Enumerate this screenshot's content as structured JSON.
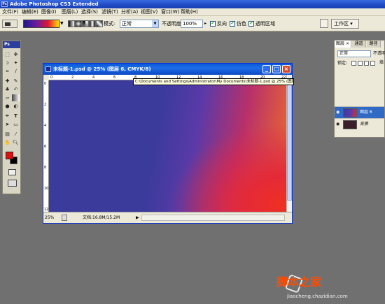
{
  "app": {
    "title": "Adobe Photoshop CS3 Extended",
    "toolbox_label": "Ps"
  },
  "menu": [
    "文件(F)",
    "编辑(E)",
    "图像(I)",
    "图层(L)",
    "选择(S)",
    "滤镜(T)",
    "分析(A)",
    "视图(V)",
    "窗口(W)",
    "帮助(H)"
  ],
  "options": {
    "mode_label": "模式:",
    "mode_value": "正常",
    "opacity_label": "不透明度:",
    "opacity_value": "100%",
    "reverse_label": "反向",
    "dither_label": "仿色",
    "transparency_label": "透明区域",
    "workspace_label": "工作区 ▾",
    "gradient_colors": [
      "#1a1a8a",
      "#6a1aa0",
      "#e01a30",
      "#ffe000"
    ]
  },
  "document": {
    "title": "未标题-1.psd @ 25% (图层 6, CMYK/8)",
    "zoom": "25%",
    "doc_size": "文档:16.8M/15.2M",
    "tooltip": "C:\\Documents and Settings\\Administrator\\My Documents\\未标题-1.psd @ 25% (图层 6, CMYK/8)",
    "ruler_top": [
      "0",
      "2",
      "4",
      "6",
      "8",
      "10",
      "12",
      "14",
      "16",
      "18",
      "20",
      "22"
    ],
    "ruler_left": [
      "0",
      "2",
      "4",
      "6",
      "8",
      "10",
      "12"
    ],
    "canvas_colors": [
      "#3b3b9c",
      "#5a3aa8",
      "#e42a38",
      "#f07028"
    ]
  },
  "layers_panel": {
    "tabs": [
      "图层 ×",
      "通道",
      "路径"
    ],
    "blend_mode": "正常",
    "opacity_label": "不透明",
    "lock_label": "锁定:",
    "fill_label": "填",
    "layers": [
      {
        "name": "图层 6",
        "selected": true
      },
      {
        "name": "背景",
        "selected": false
      }
    ]
  },
  "toolbox": {
    "tools": [
      "marquee-tool",
      "move-tool",
      "lasso-tool",
      "magic-wand-tool",
      "crop-tool",
      "slice-tool",
      "healing-brush-tool",
      "brush-tool",
      "clone-stamp-tool",
      "history-brush-tool",
      "eraser-tool",
      "gradient-tool",
      "blur-tool",
      "dodge-tool",
      "pen-tool",
      "type-tool",
      "path-selection-tool",
      "shape-tool",
      "notes-tool",
      "eyedropper-tool",
      "hand-tool",
      "zoom-tool"
    ],
    "foreground_color": "#e01010",
    "background_color": "#000000"
  },
  "watermark": {
    "text": "脚本之家",
    "sub": "jiaocheng.chazidian.com"
  }
}
